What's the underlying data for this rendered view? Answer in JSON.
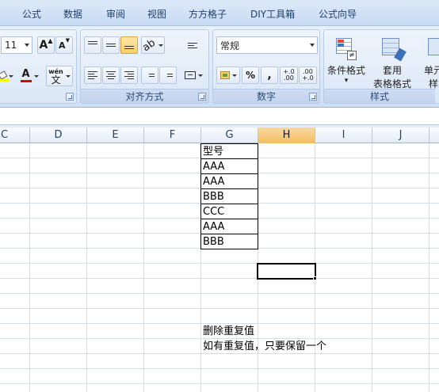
{
  "tabs": [
    "公式",
    "数据",
    "审阅",
    "视图",
    "方方格子",
    "DIY工具箱",
    "公式向导"
  ],
  "font_group": {
    "font_size": "11",
    "grow_label": "A",
    "shrink_label": "A",
    "font_color_label": "A",
    "phonetic_top": "wén",
    "phonetic_bottom": "文"
  },
  "alignment_group": {
    "label": "对齐方式"
  },
  "number_group": {
    "label": "数字",
    "format_value": "常规",
    "percent_label": "%",
    "comma_label": ",",
    "inc_decimal_label": "+.0\n.00",
    "dec_decimal_label": ".00\n+.0"
  },
  "styles_group": {
    "label": "样式",
    "conditional_format_label": "条件格式",
    "table_format_line1": "套用",
    "table_format_line2": "表格格式",
    "cell_styles_line1": "单元格",
    "cell_styles_line2": "样式"
  },
  "columns": [
    "C",
    "D",
    "E",
    "F",
    "G",
    "H",
    "I",
    "J"
  ],
  "selected_column": "H",
  "cells": {
    "g1": "型号",
    "g2": "AAA",
    "g3": "AAA",
    "g4": "BBB",
    "g5": "CCC",
    "g6": "AAA",
    "g7": "BBB",
    "note1": "删除重复值",
    "note2": "如有重复值，只要保留一个"
  },
  "colors": {
    "accent_selected_header": "#f1bd62",
    "ribbon_bg": "#dce8f7",
    "font_color_bar": "#e00000",
    "fill_color_bar": "#ffff00"
  }
}
